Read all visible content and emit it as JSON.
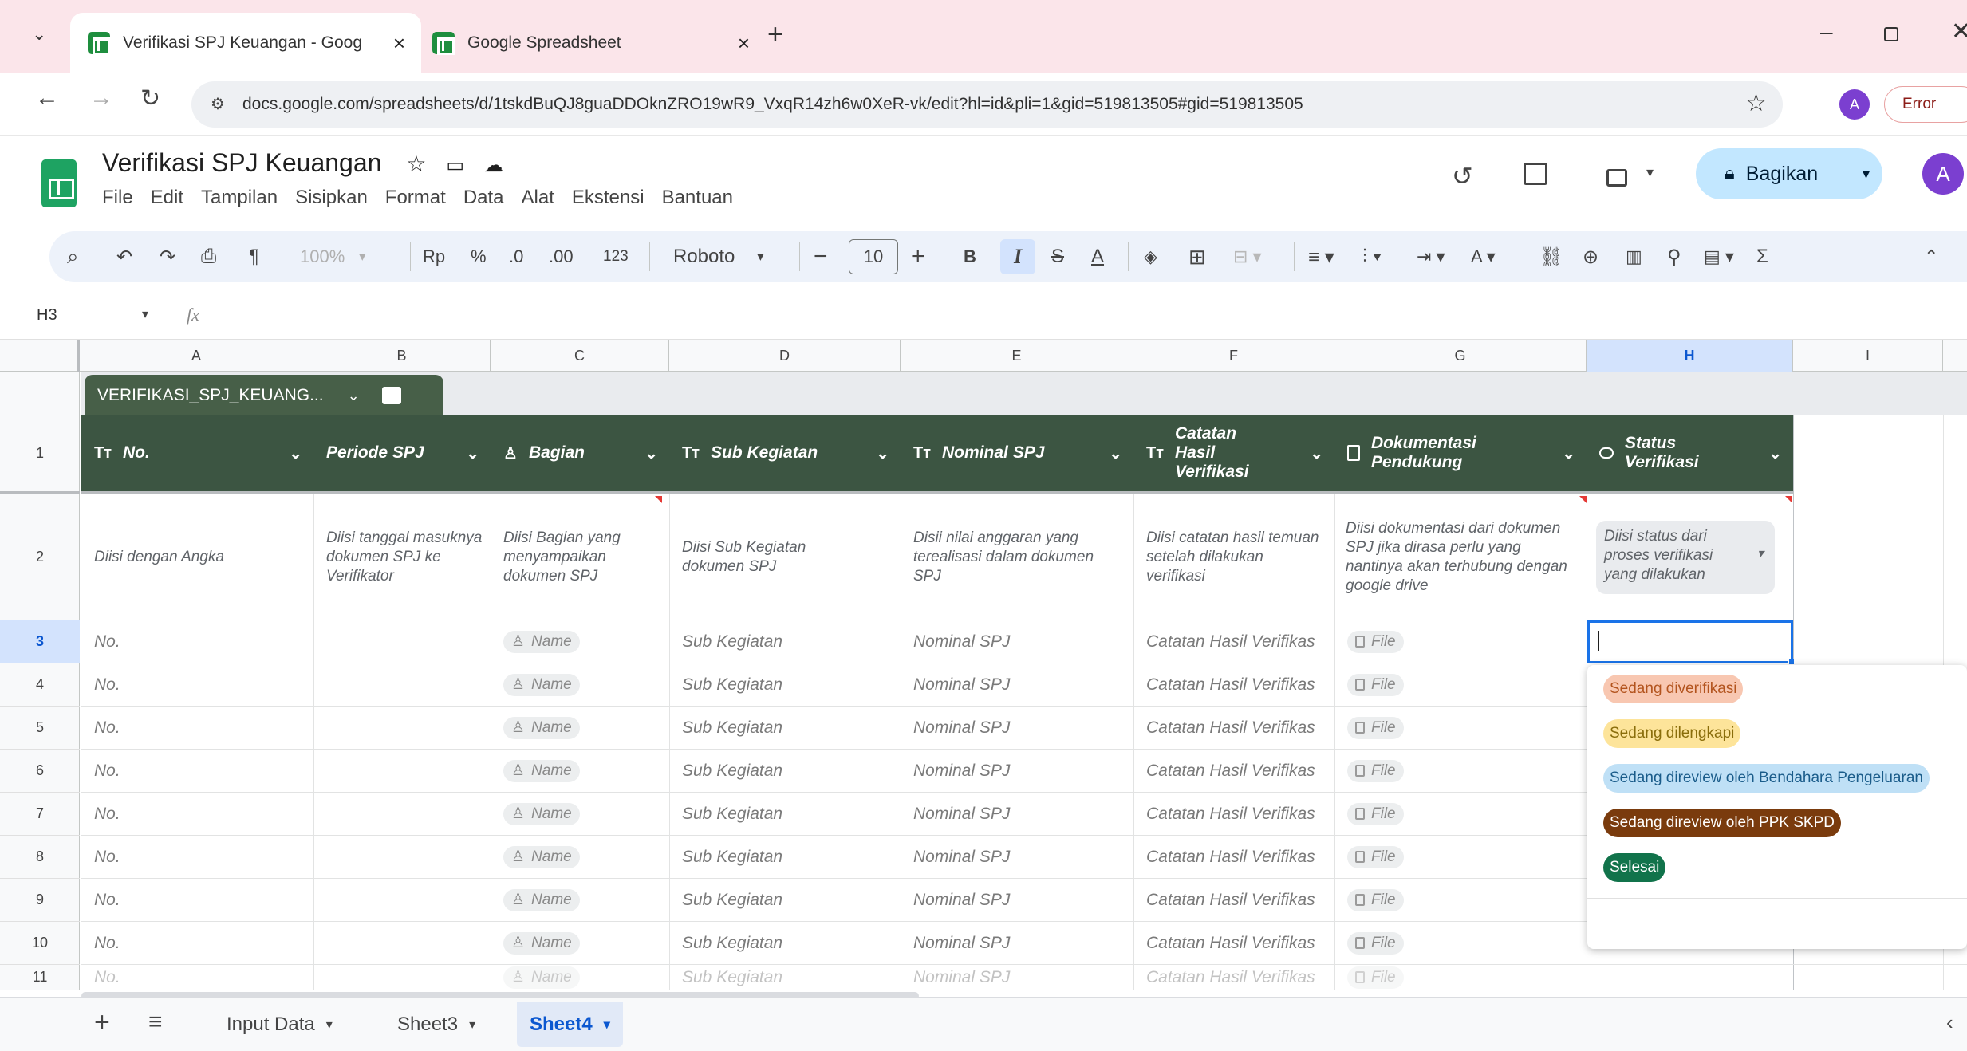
{
  "browser": {
    "tabs": [
      {
        "title": "Verifikasi SPJ Keuangan - Goog",
        "active": true
      },
      {
        "title": "Google Spreadsheet",
        "active": false
      }
    ],
    "url": "docs.google.com/spreadsheets/d/1tskdBuQJ8guaDDOknZRO19wR9_VxqR14zh6w0XeR-vk/edit?hl=id&pli=1&gid=519813505#gid=519813505",
    "profile_initial": "A",
    "error_label": "Error"
  },
  "app": {
    "title": "Verifikasi SPJ Keuangan",
    "menu": [
      "File",
      "Edit",
      "Tampilan",
      "Sisipkan",
      "Format",
      "Data",
      "Alat",
      "Ekstensi",
      "Bantuan"
    ],
    "share_label": "Bagikan",
    "avatar_initial": "A"
  },
  "toolbar": {
    "zoom": "100%",
    "currency": "Rp",
    "percent": "%",
    "dec_decrease": ".0",
    "dec_increase": ".00",
    "num_format": "123",
    "font": "Roboto",
    "font_size": "10",
    "bold": "B",
    "italic": "I",
    "sigma": "Σ"
  },
  "formula_bar": {
    "cell_ref": "H3",
    "fx": "fx",
    "value": ""
  },
  "columns": [
    "A",
    "B",
    "C",
    "D",
    "E",
    "F",
    "G",
    "H",
    "I"
  ],
  "selected_column": "H",
  "table": {
    "name": "VERIFIKASI_SPJ_KEUANG...",
    "headers": [
      {
        "type": "Tт",
        "label": "No."
      },
      {
        "type": "",
        "label": "Periode SPJ"
      },
      {
        "type": "person",
        "label": "Bagian"
      },
      {
        "type": "Tт",
        "label": "Sub Kegiatan"
      },
      {
        "type": "Tт",
        "label": "Nominal SPJ"
      },
      {
        "type": "Tт",
        "label": "Catatan Hasil Verifikasi"
      },
      {
        "type": "file",
        "label": "Dokumentasi Pendukung"
      },
      {
        "type": "dropdown",
        "label": "Status Verifikasi"
      }
    ],
    "description_row": [
      "Diisi dengan Angka",
      "Diisi tanggal masuknya dokumen SPJ ke Verifikator",
      "Diisi Bagian yang menyampaikan dokumen SPJ",
      "Diisi Sub Kegiatan dokumen SPJ",
      "Disii nilai anggaran yang terealisasi dalam dokumen SPJ",
      "Diisi catatan hasil temuan setelah dilakukan verifikasi",
      "Diisi dokumentasi dari dokumen SPJ jika dirasa perlu yang nantinya akan terhubung dengan google drive",
      "Diisi status dari proses verifikasi yang dilakukan"
    ],
    "placeholders": {
      "no": "No.",
      "bagian": "Name",
      "sub_kegiatan": "Sub Kegiatan",
      "nominal": "Nominal SPJ",
      "catatan": "Catatan Hasil Verifikas",
      "dokumentasi": "File"
    },
    "row_numbers": [
      "1",
      "2",
      "3",
      "4",
      "5",
      "6",
      "7",
      "8",
      "9",
      "10",
      "11"
    ]
  },
  "dropdown": {
    "options": [
      {
        "label": "Sedang diverifikasi",
        "bg": "#f8c7b1",
        "fg": "#b3541e"
      },
      {
        "label": "Sedang dilengkapi",
        "bg": "#fde49a",
        "fg": "#8a6d0b"
      },
      {
        "label": "Sedang direview oleh Bendahara Pengeluaran",
        "bg": "#bfe0f6",
        "fg": "#1a5c8a"
      },
      {
        "label": "Sedang direview oleh PPK SKPD",
        "bg": "#7a3b0d",
        "fg": "#ffffff"
      },
      {
        "label": "Selesai",
        "bg": "#11734b",
        "fg": "#ffffff"
      }
    ]
  },
  "sheets": {
    "tabs": [
      "Input Data",
      "Sheet3",
      "Sheet4"
    ],
    "active": "Sheet4"
  }
}
